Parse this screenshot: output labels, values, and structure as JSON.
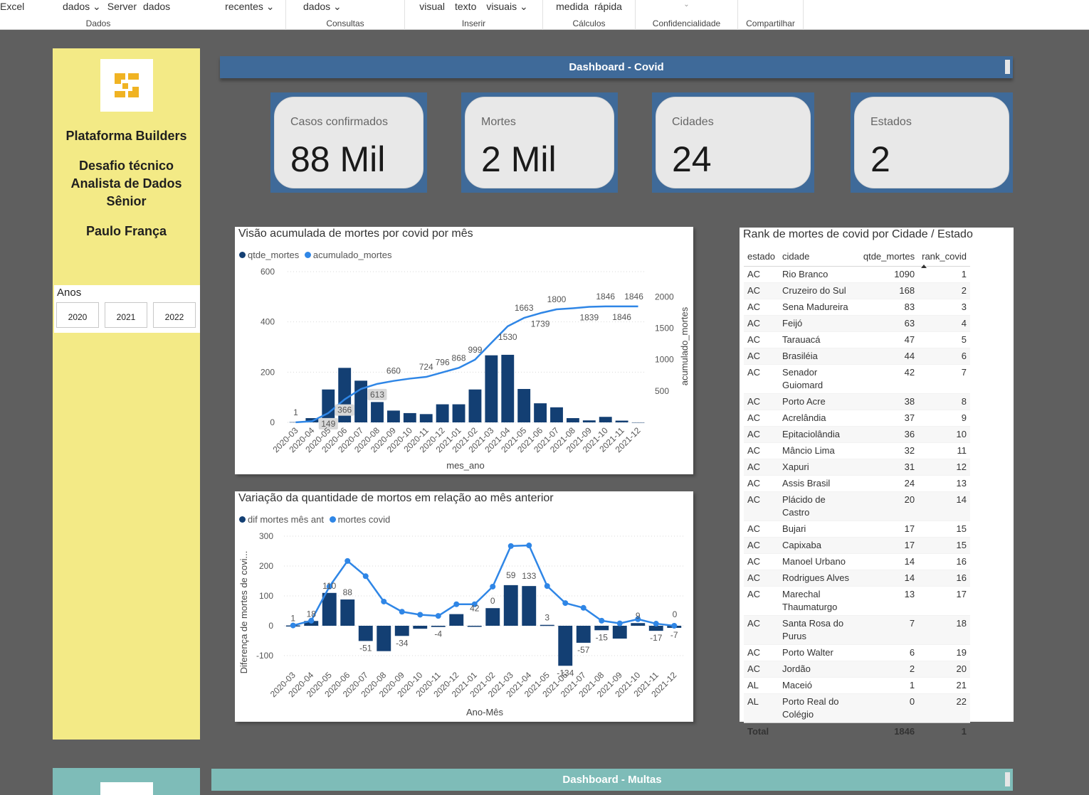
{
  "ribbon": {
    "groups": [
      {
        "items": [
          "Excel"
        ],
        "label": ""
      },
      {
        "items": [
          "dados ⌄",
          "Server",
          "dados"
        ],
        "label": "Dados"
      },
      {
        "items": [
          "recentes ⌄"
        ],
        "label": ""
      },
      {
        "items": [
          "dados ⌄"
        ],
        "label": "Consultas"
      },
      {
        "items": [
          "visual",
          "texto",
          "visuais ⌄"
        ],
        "label": "Inserir"
      },
      {
        "items": [
          "medida",
          "rápida"
        ],
        "label": "Cálculos"
      },
      {
        "items": [
          "⌄"
        ],
        "label": "Confidencialidade"
      },
      {
        "items": [],
        "label": "Compartilhar"
      }
    ]
  },
  "sidebar": {
    "company": "Plataforma Builders",
    "subtitle_1": "Desafio técnico",
    "subtitle_2": "Analista de Dados",
    "subtitle_3": "Sênior",
    "author": "Paulo França",
    "years_title": "Anos",
    "years": [
      "2020",
      "2021",
      "2022"
    ]
  },
  "colors": {
    "dark_blue": "#133f73",
    "light_blue": "#2f86e6",
    "header_bar": "#3f6a99",
    "sidebar": "#f3ea86",
    "teal": "#7ebcb8"
  },
  "header": {
    "title": "Dashboard - Covid"
  },
  "kpis": [
    {
      "label": "Casos confirmados",
      "value": "88 Mil"
    },
    {
      "label": "Mortes",
      "value": "2 Mil"
    },
    {
      "label": "Cidades",
      "value": "24"
    },
    {
      "label": "Estados",
      "value": "2"
    }
  ],
  "chart1": {
    "title": "Visão acumulada de mortes por covid por mês",
    "legend": [
      "qtde_mortes",
      "acumulado_mortes"
    ],
    "xlabel": "mes_ano",
    "ylabel_left": "qtde_mortes",
    "ylabel_right": "acumulado_mortes"
  },
  "chart2": {
    "title": "Variação da quantidade de mortos em relação ao mês anterior",
    "legend": [
      "dif mortes mês ant",
      "mortes covid"
    ],
    "xlabel": "Ano-Mês",
    "ylabel": "Diferença de mortes de covi..."
  },
  "chart_data": [
    {
      "type": "bar",
      "title": "Visão acumulada de mortes por covid por mês",
      "xlabel": "mes_ano",
      "ylabel": "qtde_mortes",
      "y2label": "acumulado_mortes",
      "categories": [
        "2020-03",
        "2020-04",
        "2020-05",
        "2020-06",
        "2020-07",
        "2020-08",
        "2020-09",
        "2020-10",
        "2020-11",
        "2020-12",
        "2021-01",
        "2021-02",
        "2021-03",
        "2021-04",
        "2021-05",
        "2021-06",
        "2021-07",
        "2021-08",
        "2021-09",
        "2021-10",
        "2021-11",
        "2021-12"
      ],
      "ylim": [
        0,
        600
      ],
      "y2lim": [
        0,
        2400
      ],
      "yticks": [
        0,
        200,
        400,
        600
      ],
      "y2ticks": [
        500,
        1000,
        1500,
        2000
      ],
      "series": [
        {
          "name": "qtde_mortes",
          "type": "bar",
          "values": [
            1,
            17,
            131,
            217,
            166,
            81,
            47,
            37,
            33,
            72,
            72,
            131,
            267,
            269,
            133,
            76,
            60,
            17,
            8,
            22,
            7,
            0
          ]
        },
        {
          "name": "acumulado_mortes",
          "type": "line",
          "values": [
            1,
            18,
            149,
            366,
            532,
            613,
            660,
            697,
            724,
            796,
            868,
            999,
            1266,
            1530,
            1663,
            1739,
            1800,
            1817,
            1839,
            1846,
            1846,
            1846
          ],
          "labels": [
            "1",
            "",
            "149",
            "366",
            "",
            "613",
            "660",
            "",
            "724",
            "796",
            "868",
            "999",
            "",
            "1530",
            "1663",
            "1739",
            "1800",
            "",
            "1839",
            "1846",
            "1846",
            "1846"
          ]
        }
      ]
    },
    {
      "type": "bar",
      "title": "Variação da quantidade de mortos em relação ao mês anterior",
      "xlabel": "Ano-Mês",
      "ylabel": "Diferença de mortes de covi...",
      "categories": [
        "2020-03",
        "2020-04",
        "2020-05",
        "2020-06",
        "2020-07",
        "2020-08",
        "2020-09",
        "2020-10",
        "2020-11",
        "2020-12",
        "2021-01",
        "2021-02",
        "2021-03",
        "2021-04",
        "2021-05",
        "2021-06",
        "2021-07",
        "2021-08",
        "2021-09",
        "2021-10",
        "2021-11",
        "2021-12"
      ],
      "ylim": [
        -100,
        300
      ],
      "yticks": [
        -100,
        0,
        100,
        200,
        300
      ],
      "series": [
        {
          "name": "dif mortes mês ant",
          "type": "bar",
          "values": [
            1,
            16,
            110,
            88,
            -51,
            -85,
            -34,
            -10,
            -4,
            39,
            0,
            59,
            136,
            133,
            3,
            -134,
            -57,
            -15,
            -43,
            9,
            -17,
            -7
          ],
          "labels": [
            "1",
            "18",
            "110",
            "88",
            "-51",
            "",
            "-34",
            "",
            "-4",
            "",
            "42",
            "0",
            "59",
            "133",
            "3",
            "-134",
            "-57",
            "-15",
            "",
            "9",
            "-17",
            "-7"
          ]
        },
        {
          "name": "mortes covid",
          "type": "line",
          "values": [
            1,
            17,
            131,
            217,
            166,
            81,
            47,
            37,
            33,
            72,
            72,
            131,
            267,
            269,
            133,
            76,
            60,
            17,
            8,
            22,
            7,
            0
          ]
        }
      ],
      "end_label": "0"
    }
  ],
  "rank_table": {
    "title": "Rank de mortes de covid por Cidade / Estado",
    "columns": [
      "estado",
      "cidade",
      "qtde_mortes",
      "rank_covid"
    ],
    "rows": [
      [
        "AC",
        "Rio Branco",
        "1090",
        "1"
      ],
      [
        "AC",
        "Cruzeiro do Sul",
        "168",
        "2"
      ],
      [
        "AC",
        "Sena Madureira",
        "83",
        "3"
      ],
      [
        "AC",
        "Feijó",
        "63",
        "4"
      ],
      [
        "AC",
        "Tarauacá",
        "47",
        "5"
      ],
      [
        "AC",
        "Brasiléia",
        "44",
        "6"
      ],
      [
        "AC",
        "Senador Guiomard",
        "42",
        "7"
      ],
      [
        "AC",
        "Porto Acre",
        "38",
        "8"
      ],
      [
        "AC",
        "Acrelândia",
        "37",
        "9"
      ],
      [
        "AC",
        "Epitaciolândia",
        "36",
        "10"
      ],
      [
        "AC",
        "Mâncio Lima",
        "32",
        "11"
      ],
      [
        "AC",
        "Xapuri",
        "31",
        "12"
      ],
      [
        "AC",
        "Assis Brasil",
        "24",
        "13"
      ],
      [
        "AC",
        "Plácido de Castro",
        "20",
        "14"
      ],
      [
        "AC",
        "Bujari",
        "17",
        "15"
      ],
      [
        "AC",
        "Capixaba",
        "17",
        "15"
      ],
      [
        "AC",
        "Manoel Urbano",
        "14",
        "16"
      ],
      [
        "AC",
        "Rodrigues Alves",
        "14",
        "16"
      ],
      [
        "AC",
        "Marechal Thaumaturgo",
        "13",
        "17"
      ],
      [
        "AC",
        "Santa Rosa do Purus",
        "7",
        "18"
      ],
      [
        "AC",
        "Porto Walter",
        "6",
        "19"
      ],
      [
        "AC",
        "Jordão",
        "2",
        "20"
      ],
      [
        "AL",
        "Maceió",
        "1",
        "21"
      ],
      [
        "AL",
        "Porto Real do Colégio",
        "0",
        "22"
      ]
    ],
    "total_label": "Total",
    "total_mortes": "1846",
    "total_rank": "1"
  },
  "footer": {
    "title": "Dashboard - Multas"
  }
}
